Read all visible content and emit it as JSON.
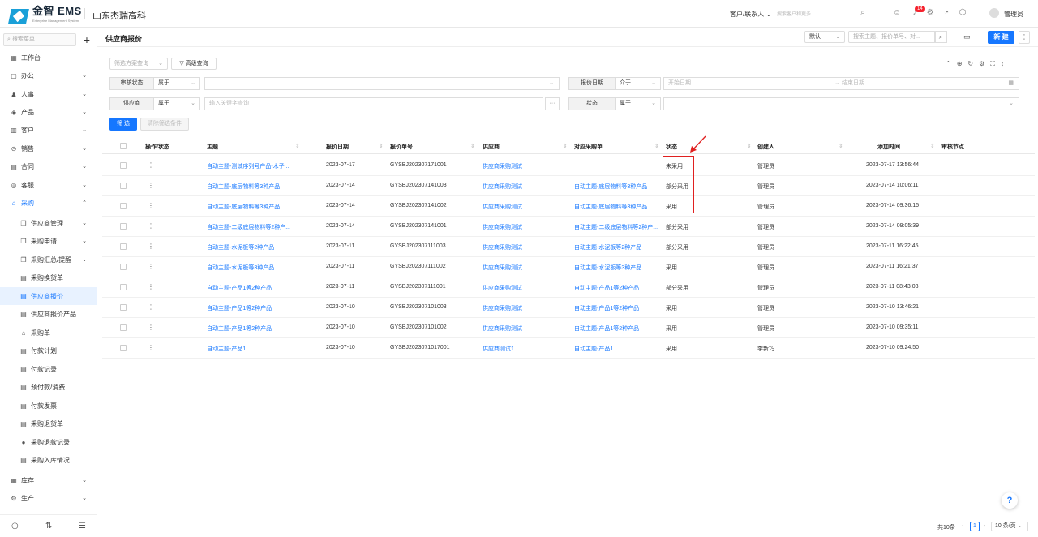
{
  "app": {
    "logo_text": "金智 EMS",
    "logo_sub": "Enterprise Management System",
    "company": "山东杰瑞高科"
  },
  "topbar": {
    "customer_select": "客户/联系人 ⌄",
    "customer_search_placeholder": "搜索客户和更多",
    "notification_count": "14",
    "user_name": "管理员"
  },
  "sidebar": {
    "search_placeholder": "搜索菜单",
    "items": [
      {
        "label": "工作台",
        "icon": "▦"
      },
      {
        "label": "办公",
        "icon": "▢"
      },
      {
        "label": "人事",
        "icon": "♟"
      },
      {
        "label": "产品",
        "icon": "◈"
      },
      {
        "label": "客户",
        "icon": "▥"
      },
      {
        "label": "销售",
        "icon": "⊙"
      },
      {
        "label": "合同",
        "icon": "▤"
      },
      {
        "label": "客服",
        "icon": "◎"
      },
      {
        "label": "采购",
        "icon": "⌂"
      }
    ],
    "sub_items": [
      {
        "label": "供应商管理",
        "icon": "❐"
      },
      {
        "label": "采购申请",
        "icon": "❐"
      },
      {
        "label": "采购汇总/提醒",
        "icon": "❐"
      },
      {
        "label": "采购换货单",
        "icon": "▤"
      },
      {
        "label": "供应商报价",
        "icon": "▤"
      },
      {
        "label": "供应商报价产品",
        "icon": "▤"
      },
      {
        "label": "采购单",
        "icon": "⌂"
      },
      {
        "label": "付款计划",
        "icon": "▤"
      },
      {
        "label": "付款记录",
        "icon": "▤"
      },
      {
        "label": "预付款/消费",
        "icon": "▤"
      },
      {
        "label": "付款发票",
        "icon": "▤"
      },
      {
        "label": "采购退货单",
        "icon": "▤"
      },
      {
        "label": "采购退款记录",
        "icon": "●"
      },
      {
        "label": "采购入库情况",
        "icon": "▤"
      }
    ],
    "bottom_items": [
      {
        "label": "库存",
        "icon": "▦"
      },
      {
        "label": "生产",
        "icon": "⚙"
      }
    ]
  },
  "main": {
    "title": "供应商报价",
    "view_select": "默认",
    "search_placeholder": "搜索主题、报价单号、对...",
    "new_button": "新 建"
  },
  "filters": {
    "plan_placeholder": "筛选方案查询",
    "advanced_button": "高级查询",
    "rows": [
      {
        "label": "审核状态",
        "op": "属于",
        "value": ""
      },
      {
        "label": "报价日期",
        "op": "介于",
        "start": "开始日期",
        "end": "结束日期"
      },
      {
        "label": "供应商",
        "op": "属于",
        "value": "输入关键字查询"
      },
      {
        "label": "状态",
        "op": "属于",
        "value": ""
      }
    ],
    "filter_button": "筛 选",
    "clear_button": "清除筛选条件"
  },
  "table": {
    "columns": [
      "操作/状态",
      "主题",
      "报价日期",
      "报价单号",
      "供应商",
      "对应采购单",
      "状态",
      "创建人",
      "添加时间",
      "审核节点"
    ],
    "rows": [
      {
        "subject": "自动主题-测试序列号产品-木子...",
        "date": "2023-07-17",
        "no": "GYSBJ202307171001",
        "supplier": "供应商采购测试",
        "po": "",
        "status": "未采用",
        "creator": "管理员",
        "time": "2023-07-17 13:56:44"
      },
      {
        "subject": "自动主题-底层物料等3种产品",
        "date": "2023-07-14",
        "no": "GYSBJ202307141003",
        "supplier": "供应商采购测试",
        "po": "自动主题-底层物料等3种产品",
        "status": "部分采用",
        "creator": "管理员",
        "time": "2023-07-14 10:06:11"
      },
      {
        "subject": "自动主题-底层物料等3种产品",
        "date": "2023-07-14",
        "no": "GYSBJ202307141002",
        "supplier": "供应商采购测试",
        "po": "自动主题-底层物料等3种产品",
        "status": "采用",
        "creator": "管理员",
        "time": "2023-07-14 09:36:15"
      },
      {
        "subject": "自动主题-二级底层物料等2种产...",
        "date": "2023-07-14",
        "no": "GYSBJ202307141001",
        "supplier": "供应商采购测试",
        "po": "自动主题-二级底层物料等2种产...",
        "status": "部分采用",
        "creator": "管理员",
        "time": "2023-07-14 09:05:39"
      },
      {
        "subject": "自动主题-水泥板等2种产品",
        "date": "2023-07-11",
        "no": "GYSBJ202307111003",
        "supplier": "供应商采购测试",
        "po": "自动主题-水泥板等2种产品",
        "status": "部分采用",
        "creator": "管理员",
        "time": "2023-07-11 16:22:45"
      },
      {
        "subject": "自动主题-水泥板等3种产品",
        "date": "2023-07-11",
        "no": "GYSBJ202307111002",
        "supplier": "供应商采购测试",
        "po": "自动主题-水泥板等3种产品",
        "status": "采用",
        "creator": "管理员",
        "time": "2023-07-11 16:21:37"
      },
      {
        "subject": "自动主题-产品1等2种产品",
        "date": "2023-07-11",
        "no": "GYSBJ202307111001",
        "supplier": "供应商采购测试",
        "po": "自动主题-产品1等2种产品",
        "status": "部分采用",
        "creator": "管理员",
        "time": "2023-07-11 08:43:03"
      },
      {
        "subject": "自动主题-产品1等2种产品",
        "date": "2023-07-10",
        "no": "GYSBJ202307101003",
        "supplier": "供应商采购测试",
        "po": "自动主题-产品1等2种产品",
        "status": "采用",
        "creator": "管理员",
        "time": "2023-07-10 13:46:21"
      },
      {
        "subject": "自动主题-产品1等2种产品",
        "date": "2023-07-10",
        "no": "GYSBJ202307101002",
        "supplier": "供应商采购测试",
        "po": "自动主题-产品1等2种产品",
        "status": "采用",
        "creator": "管理员",
        "time": "2023-07-10 09:35:11"
      },
      {
        "subject": "自动主题-产品1",
        "date": "2023-07-10",
        "no": "GYSBJ2023071017001",
        "supplier": "供应商测试1",
        "po": "自动主题-产品1",
        "status": "采用",
        "creator": "李新巧",
        "time": "2023-07-10 09:24:50"
      }
    ]
  },
  "pager": {
    "total": "共10条",
    "page": "1",
    "page_size": "10 条/页"
  },
  "colors": {
    "accent": "#1677ff",
    "highlight": "#e02020"
  }
}
